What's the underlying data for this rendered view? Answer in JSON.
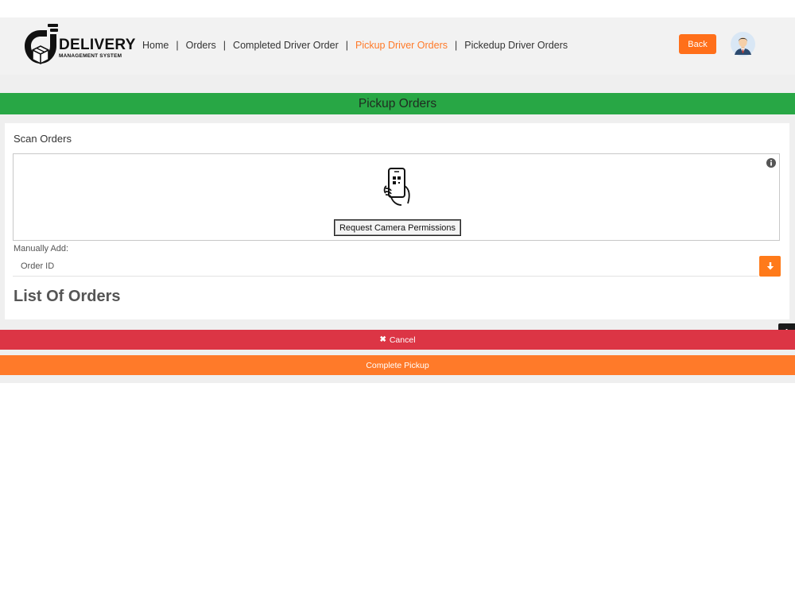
{
  "brand": {
    "name": "DELIVERY",
    "subtitle": "MANAGEMENT SYSTEM"
  },
  "nav": {
    "items": [
      {
        "label": "Home",
        "active": false
      },
      {
        "label": "Orders",
        "active": false
      },
      {
        "label": "Completed Driver Order",
        "active": false
      },
      {
        "label": "Pickup Driver Orders",
        "active": true
      },
      {
        "label": "Pickedup Driver Orders",
        "active": false
      }
    ],
    "separator": "|"
  },
  "header": {
    "back_label": "Back",
    "avatar_icon": "user-avatar-icon"
  },
  "page": {
    "title": "Pickup Orders"
  },
  "scan": {
    "label": "Scan Orders",
    "info_icon": "info-circle-icon",
    "phone_icon": "qr-phone-icon",
    "camera_button": "Request Camera Permissions"
  },
  "manual": {
    "label": "Manually Add:",
    "placeholder": "Order ID",
    "value": "",
    "add_icon": "arrow-down-icon"
  },
  "orders": {
    "title": "List Of Orders",
    "items": []
  },
  "actions": {
    "cancel_icon": "✖",
    "cancel_label": "Cancel",
    "complete_label": "Complete Pickup"
  },
  "colors": {
    "accent": "#ff7a29",
    "title_bar": "#28a745",
    "cancel": "#dc3545",
    "complete": "#ff7a29"
  }
}
